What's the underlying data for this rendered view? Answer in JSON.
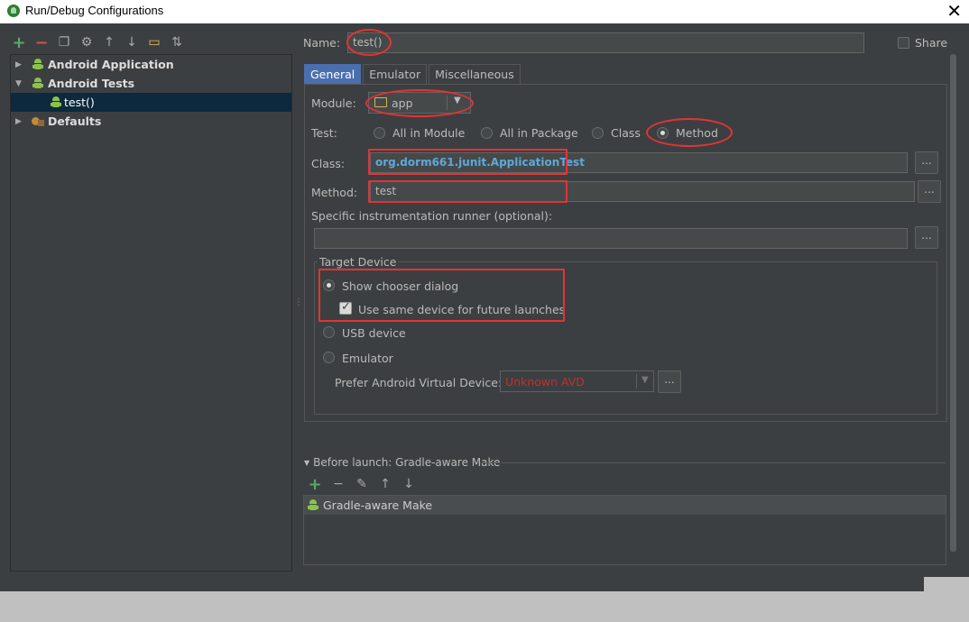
{
  "window": {
    "title": "Run/Debug Configurations",
    "close": "✕"
  },
  "toolbar": {
    "items": [
      {
        "name": "add-icon",
        "glyph": "+"
      },
      {
        "name": "remove-icon",
        "glyph": "−"
      },
      {
        "name": "copy-icon",
        "glyph": "❐"
      },
      {
        "name": "wrench-icon",
        "glyph": "⚙"
      },
      {
        "name": "move-up-icon",
        "glyph": "↑"
      },
      {
        "name": "move-down-icon",
        "glyph": "↓"
      },
      {
        "name": "folder-icon",
        "glyph": "▭"
      },
      {
        "name": "sort-icon",
        "glyph": "⇅"
      }
    ]
  },
  "tree": {
    "android_application": "Android Application",
    "android_tests": "Android Tests",
    "test_item": "test()",
    "defaults": "Defaults"
  },
  "name": {
    "label": "Name:",
    "value": "test()"
  },
  "share": {
    "label": "Share"
  },
  "tabs": {
    "general": "General",
    "emulator": "Emulator",
    "misc": "Miscellaneous"
  },
  "module": {
    "label": "Module:",
    "value": "app"
  },
  "test": {
    "label": "Test:",
    "all_in_module": "All in Module",
    "all_in_package": "All in Package",
    "class": "Class",
    "method": "Method"
  },
  "class_field": {
    "label": "Class:",
    "value": "org.dorm661.junit.ApplicationTest"
  },
  "method_field": {
    "label": "Method:",
    "value": "test"
  },
  "runner": {
    "label": "Specific instrumentation runner (optional):",
    "value": ""
  },
  "target": {
    "legend": "Target Device",
    "show_chooser": "Show chooser dialog",
    "same_device": "Use same device for future launches",
    "usb": "USB device",
    "emulator": "Emulator",
    "avd_label": "Prefer Android Virtual Device:",
    "avd_value": "Unknown AVD"
  },
  "before_launch": {
    "label": "Before launch: Gradle-aware Make",
    "task": "Gradle-aware Make"
  },
  "dots": "..."
}
